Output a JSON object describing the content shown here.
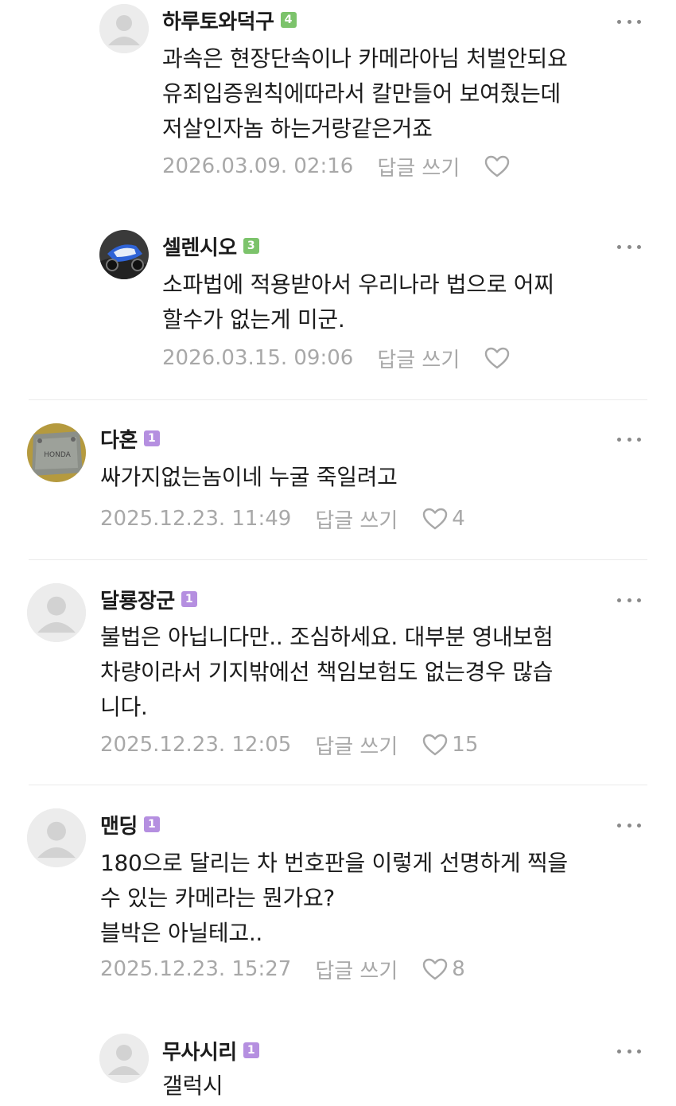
{
  "reply_label": "답글 쓰기",
  "colors": {
    "level_green": "#7cc36b",
    "level_purple": "#b58fe0"
  },
  "comments": [
    {
      "author": "하루토와덕구",
      "level": "4",
      "level_color": "#7cc36b",
      "lines": [
        "과속은 현장단속이나 카메라아님 처벌안되요",
        "유죄입증원칙에따라서 칼만들어 보여줬는데",
        "저살인자놈 하는거랑같은거죠"
      ],
      "date": "2026.03.09. 02:16",
      "likes": ""
    },
    {
      "author": "셀렌시오",
      "level": "3",
      "level_color": "#7cc36b",
      "lines": [
        "소파법에 적용받아서 우리나라 법으로 어찌",
        "할수가 없는게 미군."
      ],
      "date": "2026.03.15. 09:06",
      "likes": ""
    },
    {
      "author": "다혼",
      "level": "1",
      "level_color": "#b58fe0",
      "lines": [
        "싸가지없는놈이네 누굴 죽일려고"
      ],
      "date": "2025.12.23. 11:49",
      "likes": "4"
    },
    {
      "author": "달룡장군",
      "level": "1",
      "level_color": "#b58fe0",
      "lines": [
        "불법은 아닙니다만..  조심하세요. 대부분 영내보험",
        "차량이라서 기지밖에선 책임보험도 없는경우 많습",
        "니다."
      ],
      "date": "2025.12.23. 12:05",
      "likes": "15"
    },
    {
      "author": "맨딩",
      "level": "1",
      "level_color": "#b58fe0",
      "lines": [
        "180으로 달리는 차 번호판을 이렇게 선명하게 찍을",
        "수 있는 카메라는 뭔가요?",
        "블박은 아닐테고.."
      ],
      "date": "2025.12.23. 15:27",
      "likes": "8"
    },
    {
      "author": "무사시리",
      "level": "1",
      "level_color": "#b58fe0",
      "lines": [
        "갤럭시"
      ],
      "date": "",
      "likes": ""
    }
  ]
}
